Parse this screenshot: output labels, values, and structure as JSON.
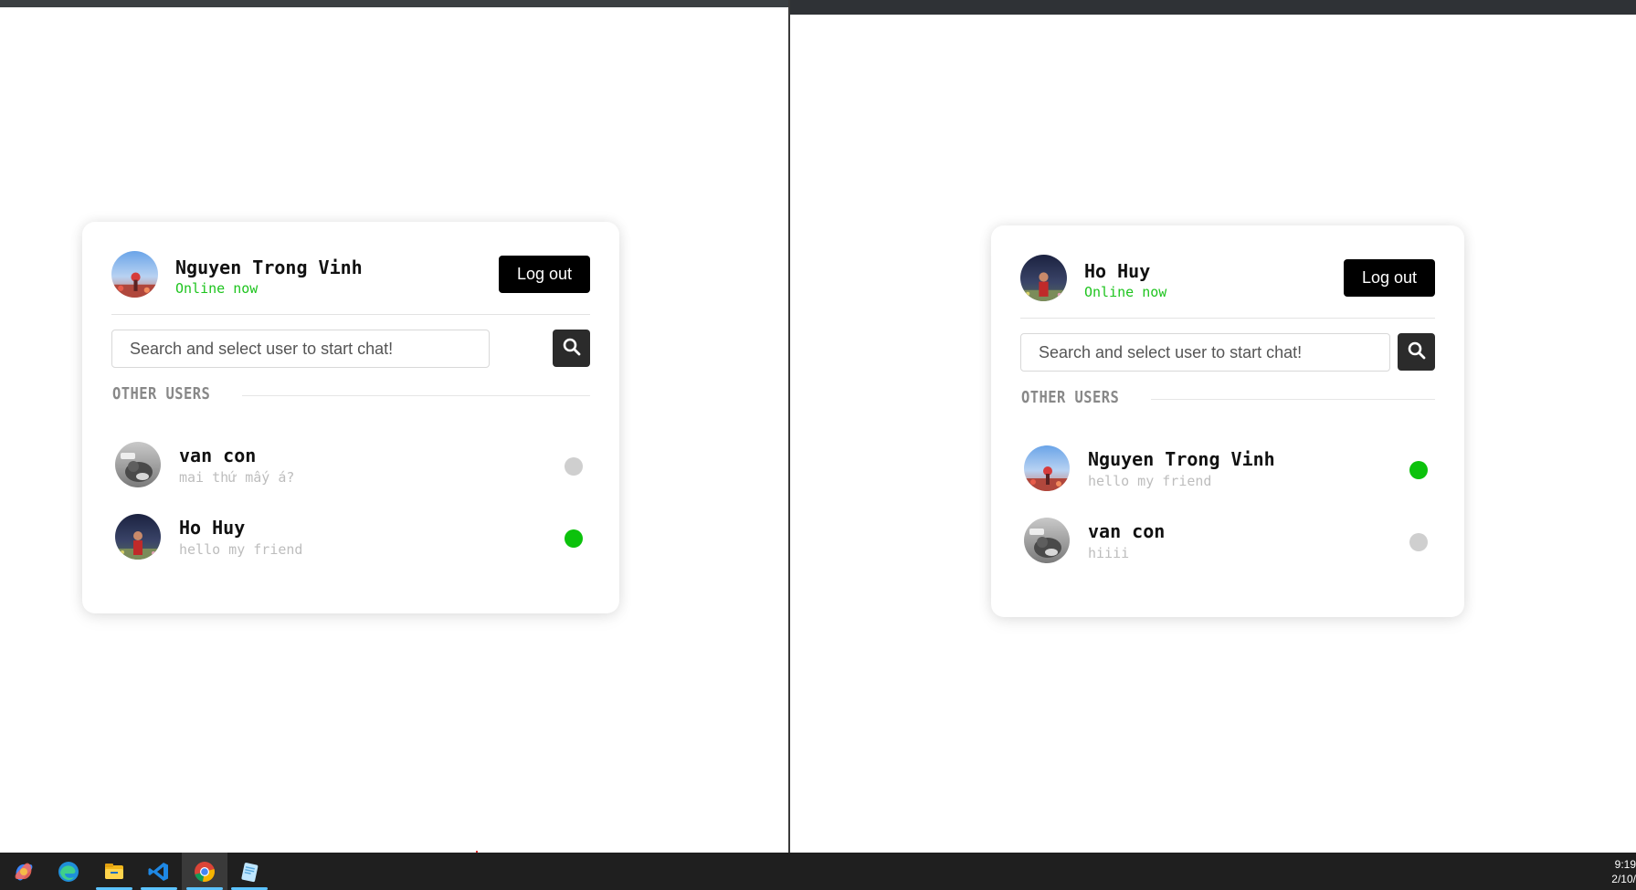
{
  "left_window": {
    "me": {
      "name": "Nguyen Trong Vinh",
      "status": "Online now"
    },
    "logout_label": "Log out",
    "search": {
      "placeholder": "Search and select user to start chat!",
      "value": ""
    },
    "section_label": "OTHER USERS",
    "users": [
      {
        "name": "van con",
        "last_message": "mai thứ mấy á?",
        "online": false
      },
      {
        "name": "Ho Huy",
        "last_message": "hello my friend",
        "online": true
      }
    ]
  },
  "right_window": {
    "me": {
      "name": "Ho Huy",
      "status": "Online now"
    },
    "logout_label": "Log out",
    "search": {
      "placeholder": "Search and select user to start chat!",
      "value": ""
    },
    "section_label": "OTHER USERS",
    "users": [
      {
        "name": "Nguyen Trong Vinh",
        "last_message": "hello my friend",
        "online": true
      },
      {
        "name": "van con",
        "last_message": "hiiii",
        "online": false
      }
    ]
  },
  "taskbar": {
    "apps": [
      "copilot-icon",
      "edge-icon",
      "file-explorer-icon",
      "vscode-icon",
      "chrome-icon",
      "notepad-icon"
    ],
    "active_app": "chrome-icon",
    "clock_time": "9:19",
    "clock_date": "2/10/"
  },
  "colors": {
    "online": "#0cc20c",
    "offline": "#cfcfcf",
    "status_text": "#1ec41e",
    "button_bg": "#000000"
  }
}
